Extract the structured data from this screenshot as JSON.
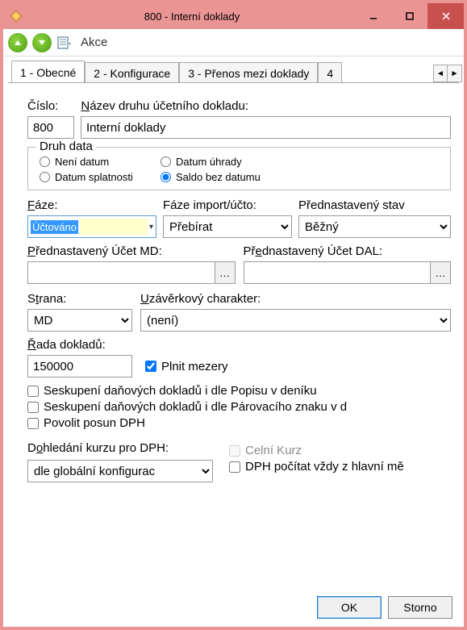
{
  "window": {
    "title": "800 - Interní doklady"
  },
  "toolbar": {
    "akce_label": "Akce"
  },
  "tabs": {
    "t1": "1 - Obecné",
    "t2": "2 - Konfigurace",
    "t3": "3 - Přenos mezi doklady",
    "t4": "4"
  },
  "labels": {
    "cislo": "Číslo:",
    "nazev": "Název druhu účetního dokladu:",
    "druh_data": "Druh data",
    "r_neni_datum": "Není datum",
    "r_datum_uhrady": "Datum úhrady",
    "r_datum_splatnosti": "Datum splatnosti",
    "r_saldo_bez_datumu": "Saldo bez datumu",
    "faze": "Fáze:",
    "faze_import": "Fáze import/účto:",
    "prednast_stav": "Přednastavený stav",
    "prednast_ucet_md": "Přednastavený Účet MD:",
    "prednast_ucet_dal": "Přednastavený Účet DAL:",
    "strana": "Strana:",
    "uzaverkovy": "Uzávěrkový charakter:",
    "rada_dokladu": "Řada dokladů:",
    "plnit_mezery": "Plnit mezery",
    "seskup_popisu": "Seskupení daňových dokladů i dle Popisu v deníku",
    "seskup_parov": "Seskupení daňových dokladů i dle Párovacího znaku v d",
    "povolit_posun": "Povolit posun DPH",
    "dohledani": "Dohledání kurzu pro DPH:",
    "celni_kurz": "Celní Kurz",
    "dph_pocitat": "DPH počítat vždy z hlavní mě"
  },
  "values": {
    "cislo": "800",
    "nazev": "Interní doklady",
    "faze": "Účtováno",
    "faze_import": "Přebírat",
    "prednast_stav": "Běžný",
    "ucet_md": "",
    "ucet_dal": "",
    "strana": "MD",
    "uzaverkovy": "(není)",
    "rada_dokladu": "150000",
    "dohledani": "dle globální konfigurac"
  },
  "buttons": {
    "ok": "OK",
    "storno": "Storno"
  },
  "checks": {
    "plnit_mezery": true,
    "seskup_popisu": false,
    "seskup_parov": false,
    "povolit_posun": false,
    "celni_kurz": false,
    "dph_pocitat": false
  },
  "radios": {
    "druh_data": "saldo_bez_datumu"
  }
}
